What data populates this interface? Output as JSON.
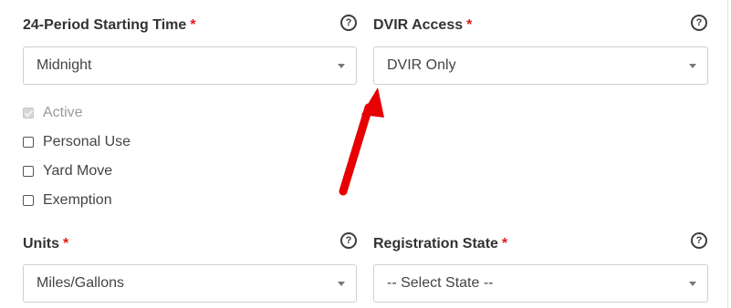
{
  "fields": {
    "period_start": {
      "label": "24-Period Starting Time",
      "required_mark": "*",
      "help_glyph": "?",
      "value": "Midnight"
    },
    "dvir_access": {
      "label": "DVIR Access",
      "required_mark": "*",
      "help_glyph": "?",
      "value": "DVIR Only"
    },
    "units": {
      "label": "Units",
      "required_mark": "*",
      "help_glyph": "?",
      "value": "Miles/Gallons"
    },
    "registration_state": {
      "label": "Registration State",
      "required_mark": "*",
      "help_glyph": "?",
      "value": "-- Select State --"
    }
  },
  "checkboxes": [
    {
      "label": "Active",
      "checked": true,
      "disabled": true
    },
    {
      "label": "Personal Use",
      "checked": false,
      "disabled": false
    },
    {
      "label": "Yard Move",
      "checked": false,
      "disabled": false
    },
    {
      "label": "Exemption",
      "checked": false,
      "disabled": false
    }
  ],
  "colors": {
    "required": "#e31b1b",
    "annotation_arrow": "#e60000"
  },
  "icons": {
    "help": "question-circle-icon",
    "dropdown": "caret-down-icon"
  }
}
